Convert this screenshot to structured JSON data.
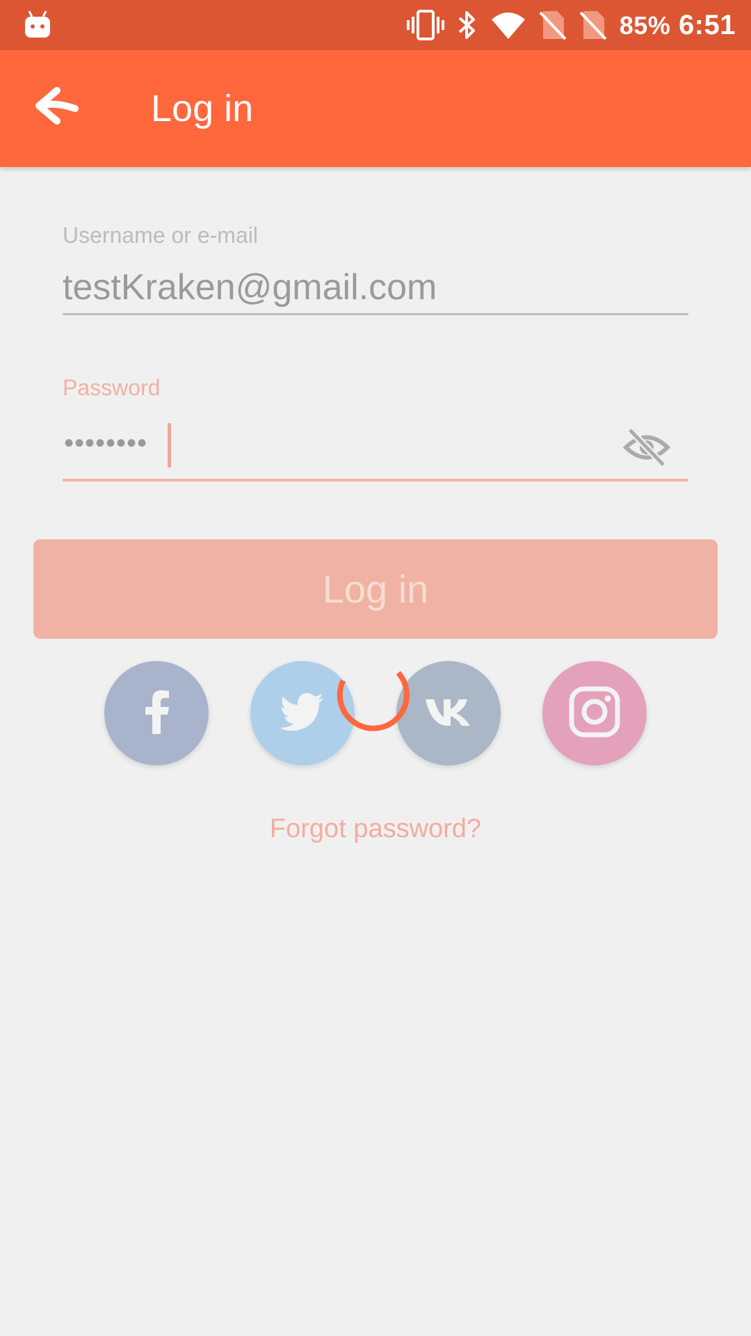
{
  "status_bar": {
    "battery": "85%",
    "time": "6:51",
    "icons": [
      "android-debug-icon",
      "vibrate-icon",
      "bluetooth-icon",
      "wifi-icon",
      "no-sim-icon",
      "no-sim-icon"
    ]
  },
  "app_bar": {
    "title": "Log in",
    "back_icon": "arrow-back-icon"
  },
  "form": {
    "username_label": "Username or e-mail",
    "username_value": "testKraken@gmail.com",
    "password_label": "Password",
    "password_mask": "••••••••",
    "visibility_icon": "eye-off-icon"
  },
  "login_button": "Log in",
  "social": [
    "facebook-icon",
    "twitter-icon",
    "vk-icon",
    "instagram-icon"
  ],
  "forgot_password": "Forgot password?",
  "colors": {
    "status_bar": "#dc5633",
    "app_bar": "#ff673d",
    "accent": "#ff673d",
    "background": "#f0f0f0"
  }
}
